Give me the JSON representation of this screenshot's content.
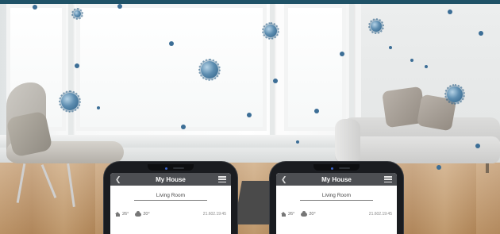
{
  "theme": {
    "accent": "#1f5267",
    "appbar": "#4d4f53",
    "virus": "#3c6e96"
  },
  "phones": [
    {
      "title": "My House",
      "back_icon": "chevron-left-icon",
      "menu_icon": "hamburger-menu-icon",
      "room": "Living Room",
      "indoor_temp": "26°",
      "outdoor_temp": "20°",
      "timestamp": "21.602.19:45"
    },
    {
      "title": "My House",
      "back_icon": "chevron-left-icon",
      "menu_icon": "hamburger-menu-icon",
      "room": "Living Room",
      "indoor_temp": "26°",
      "outdoor_temp": "20°",
      "timestamp": "21.602.19:45"
    }
  ]
}
